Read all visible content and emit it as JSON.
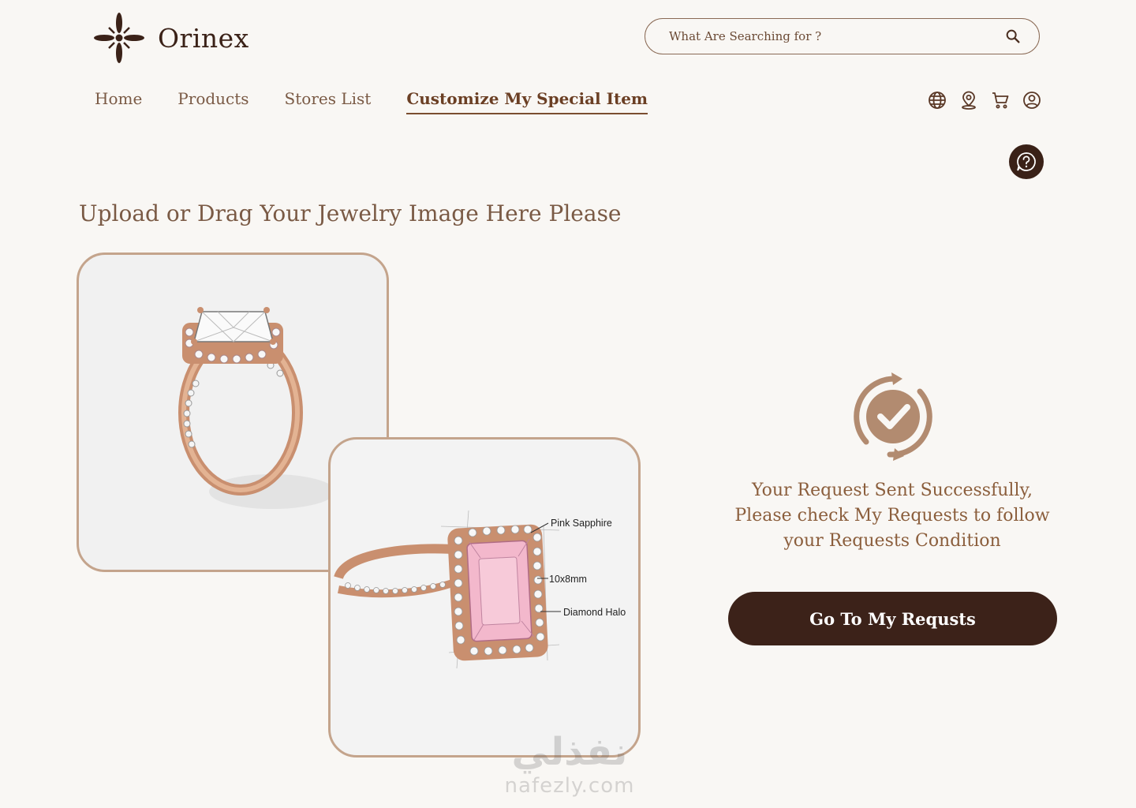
{
  "brand": {
    "name": "Orinex",
    "icon": "asterisk-flower-logo"
  },
  "search": {
    "placeholder": "What Are Searching for ?",
    "icon": "search-icon"
  },
  "nav": {
    "items": [
      {
        "label": "Home"
      },
      {
        "label": "Products"
      },
      {
        "label": "Stores List"
      },
      {
        "label": "Customize My Special Item",
        "active": true
      }
    ]
  },
  "header_icons": [
    "globe-icon",
    "location-icon",
    "cart-icon",
    "user-icon"
  ],
  "help": {
    "icon": "question-chat-icon"
  },
  "upload": {
    "heading": "Upload or Drag Your Jewelry Image Here Please"
  },
  "ring_annotations": {
    "stone": "Pink Sapphire",
    "size": "10x8mm",
    "setting": "Diamond Halo"
  },
  "success": {
    "icon": "check-circle-refresh-icon",
    "message": "Your Request Sent Successfully, Please check My Requests to follow your Requests Condition",
    "button_label": "Go To My Requsts"
  },
  "watermark": {
    "arabic": "نفذلي",
    "latin": "nafezly.com"
  },
  "colors": {
    "background": "#f9f7f4",
    "dark_brown": "#3c2219",
    "accent": "#c4a48c",
    "text": "#7a5a45"
  }
}
